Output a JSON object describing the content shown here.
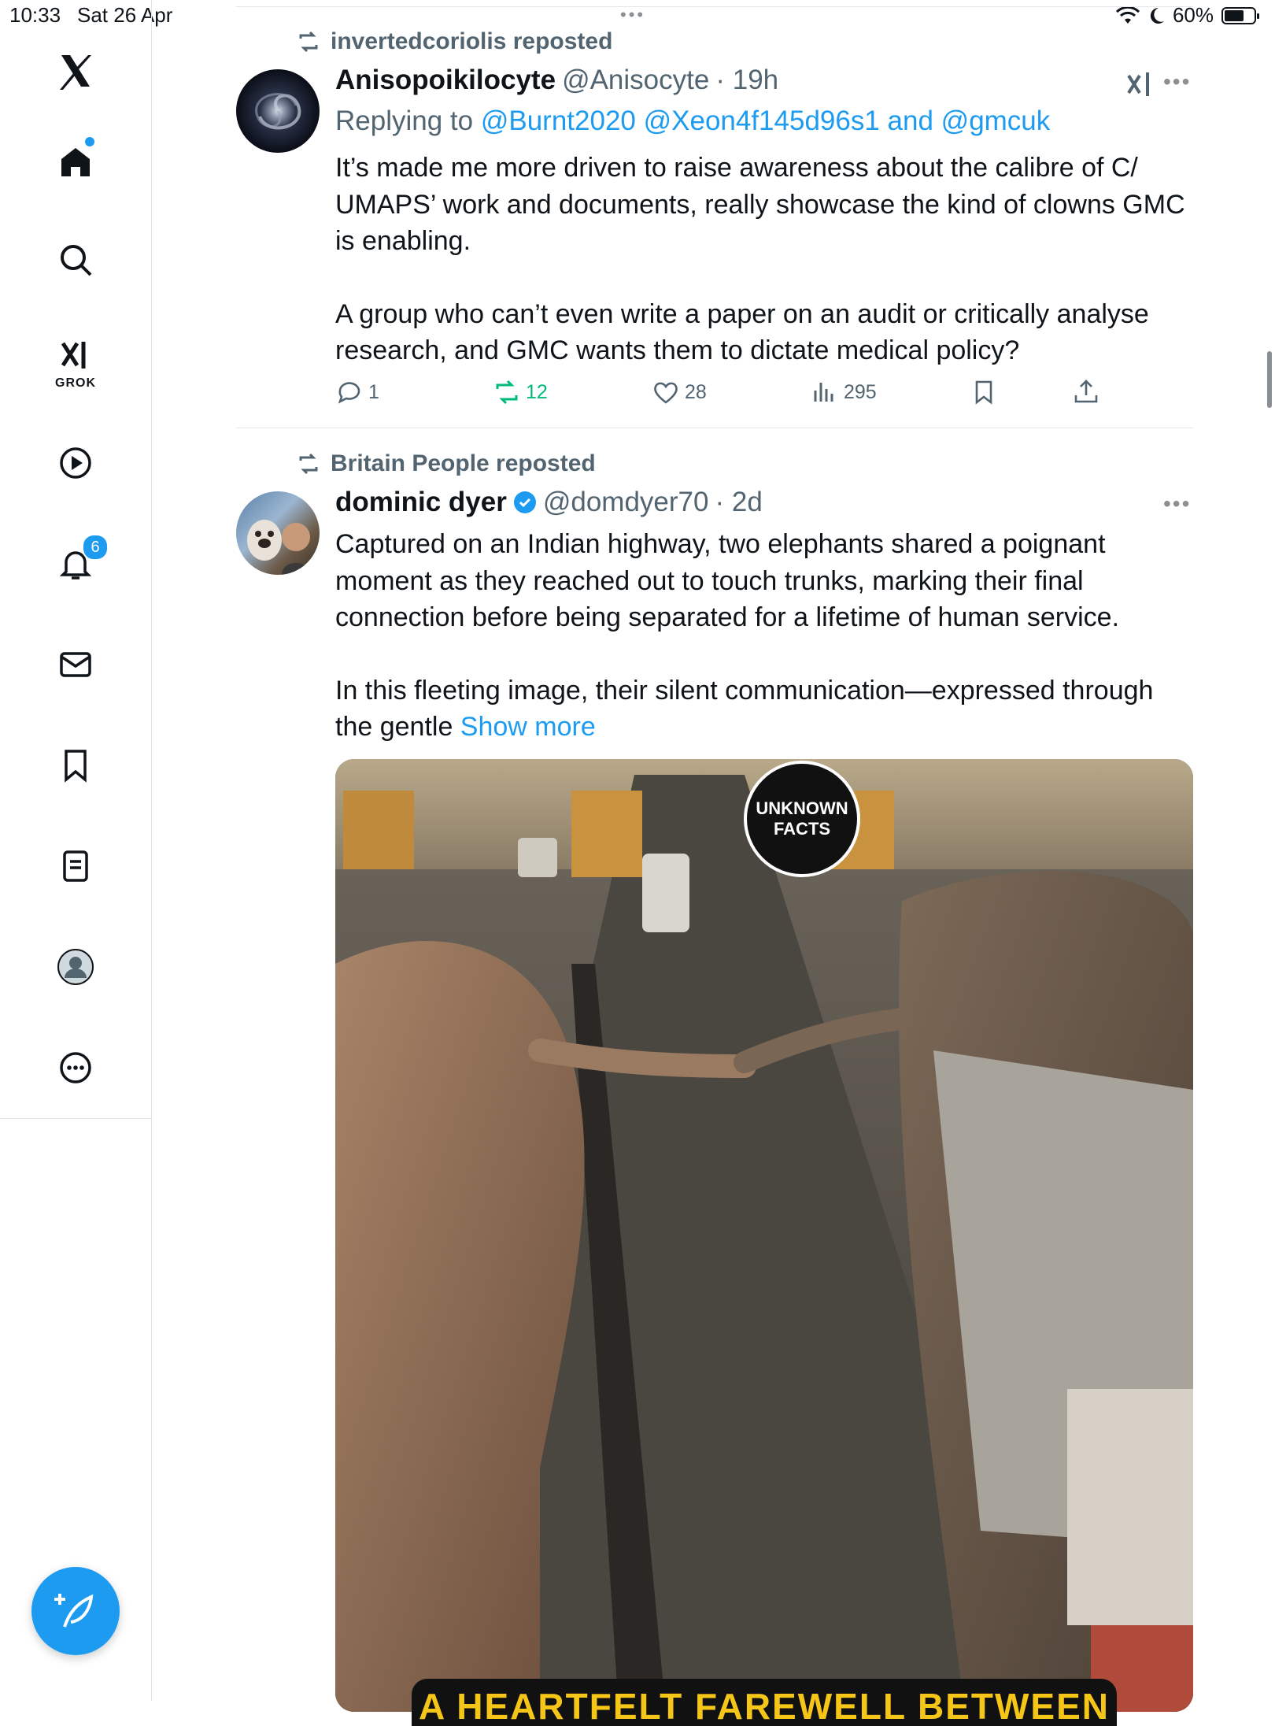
{
  "status_bar": {
    "time": "10:33",
    "date": "Sat 26 Apr",
    "battery": "60%",
    "battery_level": 0.6
  },
  "sidebar": {
    "logo": "x-logo-icon",
    "grok_label": "GROK",
    "notifications_count": "6",
    "items": [
      "home-icon",
      "search-icon",
      "grok-icon",
      "video-icon",
      "notifications-icon",
      "messages-icon",
      "bookmarks-icon",
      "lists-icon",
      "profile-icon",
      "more-icon"
    ]
  },
  "tweets": [
    {
      "reposted_by": "invertedcoriolis reposted",
      "name": "Anisopoikilocyte",
      "handle": "@Anisocyte",
      "time": "· 19h",
      "replying_prefix": "Replying to ",
      "replying_to": "@Burnt2020 @Xeon4f145d96s1 and @gmcuk",
      "paragraphs": [
        "It’s made me more driven to raise awareness about the calibre of C/ UMAPS’ work and documents, really showcase the kind of clowns GMC is enabling.",
        "A group who can’t even write a paper on an audit or critically analyse research, and GMC wants them to dictate medical  policy?"
      ],
      "stats": {
        "replies": "1",
        "reposts": "12",
        "likes": "28",
        "views": "295"
      }
    },
    {
      "reposted_by": "Britain People reposted",
      "name": "dominic dyer",
      "handle": "@domdyer70",
      "time": "· 2d",
      "paragraphs": [
        "Captured on an Indian highway, two elephants shared a poignant moment as they reached out to touch trunks, marking their final connection before being separated for a lifetime of human service.",
        "In this fleeting image, their silent communication—expressed through the gentle "
      ],
      "show_more": "Show more",
      "media": {
        "watermark_line1": "UNKNOWN",
        "watermark_line2": "FACTS",
        "caption": "A HEARTFELT FAREWELL BETWEEN TWO"
      }
    }
  ],
  "colors": {
    "accent": "#1d9bf0",
    "repost_green": "#00ba7c",
    "secondary_text": "#536471"
  }
}
